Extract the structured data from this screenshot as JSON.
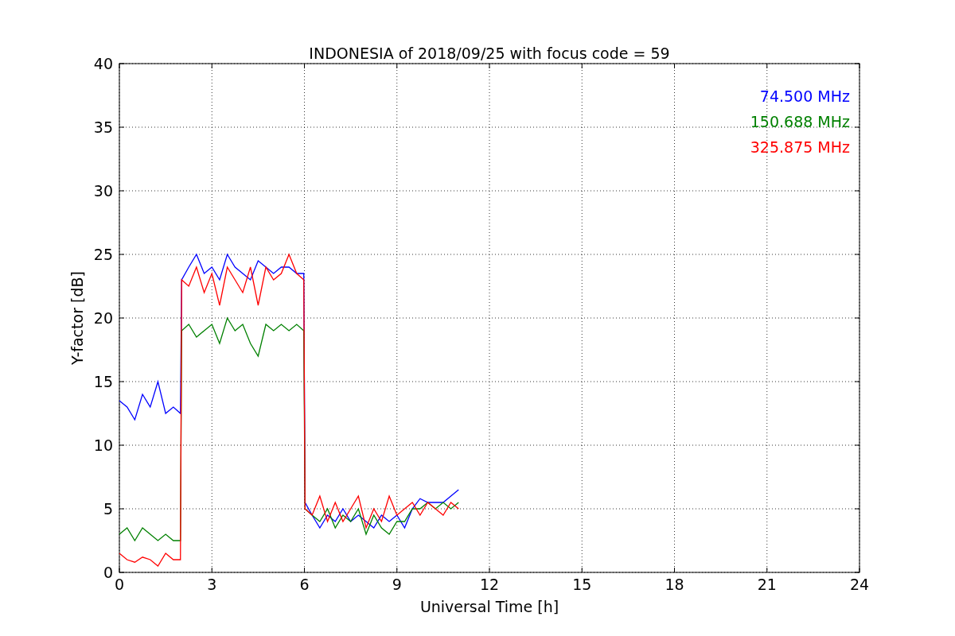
{
  "figure": {
    "chart_data": {
      "type": "line",
      "title": "INDONESIA of 2018/09/25 with focus code = 59",
      "xlabel": "Universal Time [h]",
      "ylabel": "Y-factor [dB]",
      "xlim": [
        0,
        24
      ],
      "ylim": [
        0,
        40
      ],
      "xticks": [
        0,
        3,
        6,
        9,
        12,
        15,
        18,
        21,
        24
      ],
      "yticks": [
        0,
        5,
        10,
        15,
        20,
        25,
        30,
        35,
        40
      ],
      "grid": true,
      "x": [
        0,
        0.25,
        0.5,
        0.75,
        1,
        1.25,
        1.5,
        1.75,
        1.98,
        2.02,
        2.25,
        2.5,
        2.75,
        3,
        3.25,
        3.5,
        3.75,
        4,
        4.25,
        4.5,
        4.75,
        5,
        5.25,
        5.5,
        5.75,
        5.98,
        6.02,
        6.25,
        6.5,
        6.75,
        7,
        7.25,
        7.5,
        7.75,
        8,
        8.25,
        8.5,
        8.75,
        9,
        9.25,
        9.5,
        9.75,
        10,
        10.25,
        10.5,
        10.75,
        11
      ],
      "series": [
        {
          "name": "74.500 MHz",
          "color": "#0000ff",
          "values": [
            13.5,
            13,
            12,
            14,
            13,
            15,
            12.5,
            13,
            12.5,
            23,
            24,
            25,
            23.5,
            24,
            23,
            25,
            24,
            23.5,
            23,
            24.5,
            24,
            23.5,
            24,
            24,
            23.5,
            23.5,
            5.5,
            4.5,
            3.5,
            4.5,
            4,
            5,
            4,
            4.5,
            4,
            3.5,
            4.5,
            4,
            4.5,
            3.5,
            5,
            5.8,
            5.5,
            5.5,
            5.5,
            6,
            6.5
          ]
        },
        {
          "name": "150.688 MHz",
          "color": "#008000",
          "values": [
            3,
            3.5,
            2.5,
            3.5,
            3,
            2.5,
            3,
            2.5,
            2.5,
            19,
            19.5,
            18.5,
            19,
            19.5,
            18,
            20,
            19,
            19.5,
            18,
            17,
            19.5,
            19,
            19.5,
            19,
            19.5,
            19,
            5,
            4.5,
            4,
            5,
            3.5,
            4.5,
            4,
            5,
            3,
            4.5,
            3.5,
            3,
            4,
            4,
            5,
            5,
            5.5,
            5,
            5.5,
            5,
            5.5
          ]
        },
        {
          "name": "325.875 MHz",
          "color": "#ff0000",
          "values": [
            1.5,
            1,
            0.8,
            1.2,
            1,
            0.5,
            1.5,
            1,
            1,
            23,
            22.5,
            24,
            22,
            23.5,
            21,
            24,
            23,
            22,
            24,
            21,
            24,
            23,
            23.5,
            25,
            23.5,
            23,
            5,
            4.5,
            6,
            4,
            5.5,
            4,
            5,
            6,
            3.5,
            5,
            4,
            6,
            4.5,
            5,
            5.5,
            4.5,
            5.5,
            5,
            4.5,
            5.5,
            5
          ]
        }
      ]
    }
  }
}
